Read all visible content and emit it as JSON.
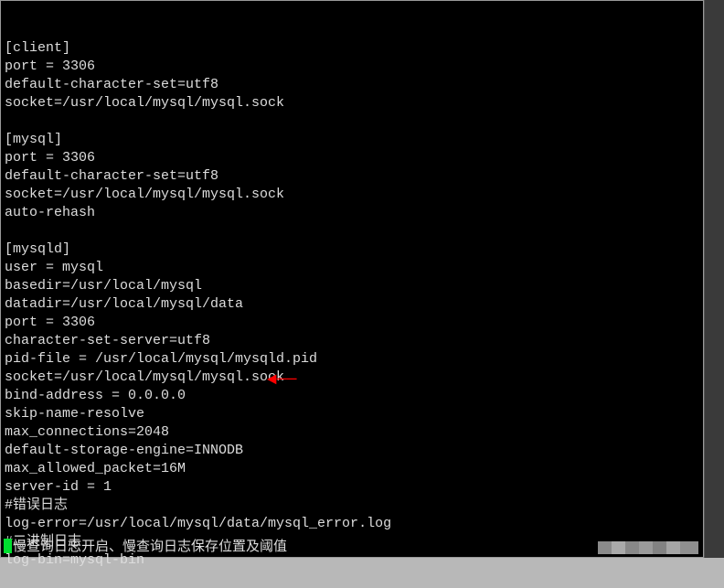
{
  "config_lines": [
    "[client]",
    "port = 3306",
    "default-character-set=utf8",
    "socket=/usr/local/mysql/mysql.sock",
    "",
    "[mysql]",
    "port = 3306",
    "default-character-set=utf8",
    "socket=/usr/local/mysql/mysql.sock",
    "auto-rehash",
    "",
    "[mysqld]",
    "user = mysql",
    "basedir=/usr/local/mysql",
    "datadir=/usr/local/mysql/data",
    "port = 3306",
    "character-set-server=utf8",
    "pid-file = /usr/local/mysql/mysqld.pid",
    "socket=/usr/local/mysql/mysql.sock",
    "bind-address = 0.0.0.0",
    "skip-name-resolve",
    "max_connections=2048",
    "default-storage-engine=INNODB",
    "max_allowed_packet=16M",
    "server-id = 1",
    "#错误日志",
    "log-error=/usr/local/mysql/data/mysql_error.log",
    "#二进制日志",
    "log-bin=mysql-bin"
  ],
  "last_line": "慢查询日志开启、慢查询日志保存位置及阈值",
  "arrow_glyph": "◄──"
}
